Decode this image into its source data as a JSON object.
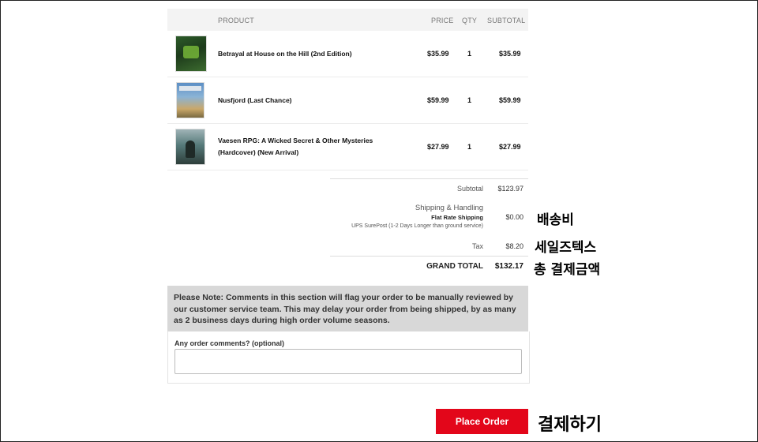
{
  "table": {
    "headers": {
      "product": "PRODUCT",
      "price": "PRICE",
      "qty": "QTY",
      "subtotal": "SUBTOTAL"
    },
    "rows": [
      {
        "name": "Betrayal at House on the Hill (2nd Edition)",
        "price": "$35.99",
        "qty": "1",
        "subtotal": "$35.99"
      },
      {
        "name": "Nusfjord (Last Chance)",
        "price": "$59.99",
        "qty": "1",
        "subtotal": "$59.99"
      },
      {
        "name_line1": "Vaesen RPG: A Wicked Secret & Other Mysteries",
        "name_line2": "(Hardcover) (New Arrival)",
        "price": "$27.99",
        "qty": "1",
        "subtotal": "$27.99"
      }
    ]
  },
  "summary": {
    "subtotal_label": "Subtotal",
    "subtotal_value": "$123.97",
    "shipping_label": "Shipping & Handling",
    "shipping_method": "Flat Rate Shipping",
    "shipping_note": "UPS SurePost (1-2 Days Longer than ground service)",
    "shipping_value": "$0.00",
    "tax_label": "Tax",
    "tax_value": "$8.20",
    "grand_total_label": "GRAND TOTAL",
    "grand_total_value": "$132.17"
  },
  "note": {
    "text": "Please Note: Comments in this section will flag your order to be manually reviewed by our customer service team. This may delay your order from being shipped, by as many as 2 business days during high order volume seasons."
  },
  "comments": {
    "label": "Any order comments? (optional)",
    "value": ""
  },
  "actions": {
    "place_order_label": "Place Order"
  },
  "annotations": {
    "shipping": "배송비",
    "tax": "세일즈텍스",
    "total": "총 결제금액",
    "checkout": "결제하기"
  },
  "colors": {
    "accent": "#e3061a",
    "note_bg": "#d8d8d8",
    "header_bg": "#f3f3f3"
  }
}
